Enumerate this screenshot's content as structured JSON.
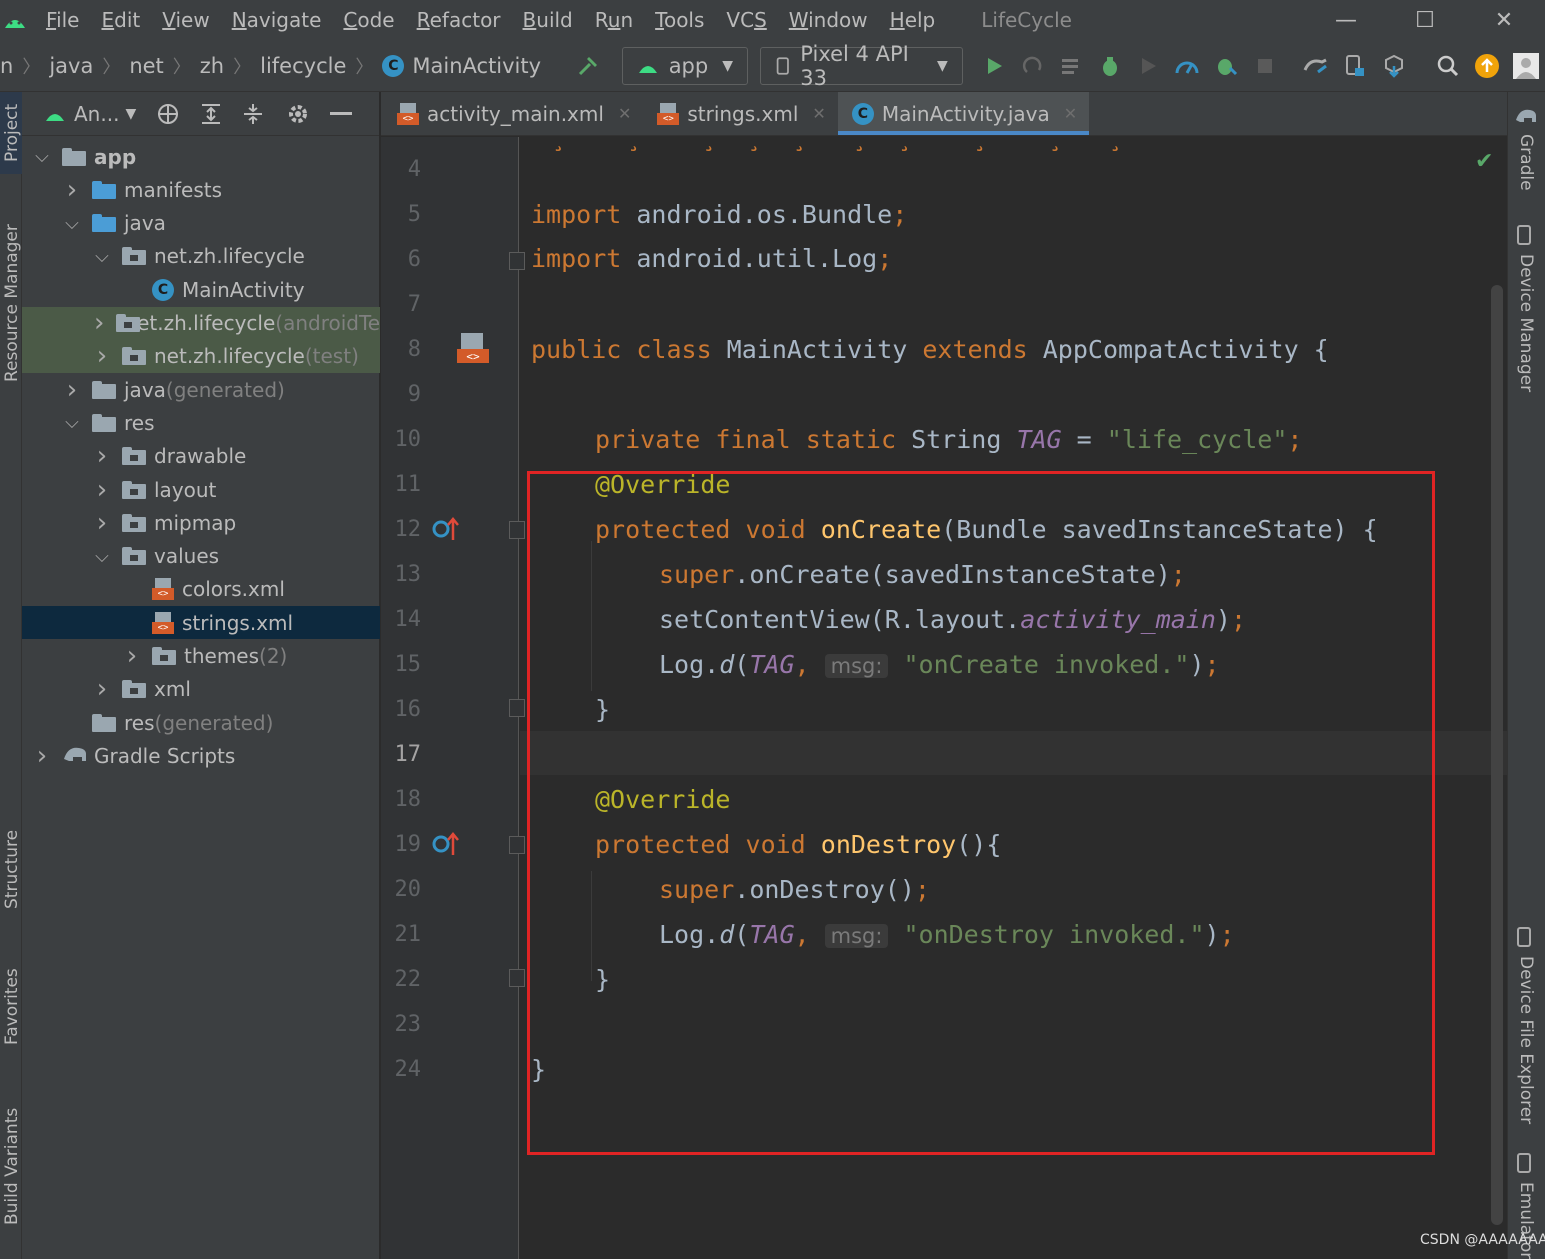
{
  "menubar": {
    "items": [
      {
        "pre": "",
        "mn": "F",
        "post": "ile"
      },
      {
        "pre": "",
        "mn": "E",
        "post": "dit"
      },
      {
        "pre": "",
        "mn": "V",
        "post": "iew"
      },
      {
        "pre": "",
        "mn": "N",
        "post": "avigate"
      },
      {
        "pre": "",
        "mn": "C",
        "post": "ode"
      },
      {
        "pre": "",
        "mn": "R",
        "post": "efactor"
      },
      {
        "pre": "",
        "mn": "B",
        "post": "uild"
      },
      {
        "pre": "R",
        "mn": "u",
        "post": "n"
      },
      {
        "pre": "",
        "mn": "T",
        "post": "ools"
      },
      {
        "pre": "VC",
        "mn": "S",
        "post": ""
      },
      {
        "pre": "",
        "mn": "W",
        "post": "indow"
      },
      {
        "pre": "",
        "mn": "H",
        "post": "elp"
      }
    ],
    "project_name": "LifeCycle",
    "window_controls": {
      "minimize": "—",
      "maximize": "☐",
      "close": "✕"
    }
  },
  "navbar": {
    "breadcrumbs": [
      "n",
      "java",
      "net",
      "zh",
      "lifecycle",
      "MainActivity"
    ],
    "run_config": "app",
    "device": "Pixel 4 API 33"
  },
  "project_panel": {
    "view_label": "An...",
    "tree": [
      {
        "label": "app",
        "muted": "",
        "chev": "v",
        "icon": "folder-gray"
      },
      {
        "label": "manifests",
        "muted": "",
        "chev": ">",
        "icon": "folder-blue"
      },
      {
        "label": "java",
        "muted": "",
        "chev": "v",
        "icon": "folder-blue"
      },
      {
        "label": "net.zh.lifecycle",
        "muted": "",
        "chev": "v",
        "icon": "package"
      },
      {
        "label": "MainActivity",
        "muted": "",
        "chev": "",
        "icon": "class"
      },
      {
        "label": "net.zh.lifecycle",
        "muted": " (androidTest)",
        "chev": ">",
        "icon": "package"
      },
      {
        "label": "net.zh.lifecycle",
        "muted": " (test)",
        "chev": ">",
        "icon": "package"
      },
      {
        "label": "java",
        "muted": " (generated)",
        "chev": ">",
        "icon": "folder-gen"
      },
      {
        "label": "res",
        "muted": "",
        "chev": "v",
        "icon": "folder-res"
      },
      {
        "label": "drawable",
        "muted": "",
        "chev": ">",
        "icon": "package"
      },
      {
        "label": "layout",
        "muted": "",
        "chev": ">",
        "icon": "package"
      },
      {
        "label": "mipmap",
        "muted": "",
        "chev": ">",
        "icon": "package"
      },
      {
        "label": "values",
        "muted": "",
        "chev": "v",
        "icon": "package"
      },
      {
        "label": "colors.xml",
        "muted": "",
        "chev": "",
        "icon": "xml"
      },
      {
        "label": "strings.xml",
        "muted": "",
        "chev": "",
        "icon": "xml"
      },
      {
        "label": "themes",
        "muted": " (2)",
        "chev": ">",
        "icon": "package"
      },
      {
        "label": "xml",
        "muted": "",
        "chev": ">",
        "icon": "package"
      },
      {
        "label": "res",
        "muted": " (generated)",
        "chev": "",
        "icon": "folder-res"
      },
      {
        "label": "Gradle Scripts",
        "muted": "",
        "chev": ">",
        "icon": "gradle"
      }
    ]
  },
  "editor_tabs": [
    {
      "label": "activity_main.xml",
      "icon": "xml"
    },
    {
      "label": "strings.xml",
      "icon": "xml"
    },
    {
      "label": "MainActivity.java",
      "icon": "class"
    }
  ],
  "active_tab": "MainActivity.java",
  "left_tool_tabs": [
    "Project",
    "Resource Manager",
    "Structure",
    "Favorites",
    "Build Variants"
  ],
  "right_tool_tabs": [
    "Gradle",
    "Device Manager",
    "Device File Explorer",
    "Emulator"
  ],
  "editor": {
    "line_numbers": [
      "4",
      "5",
      "6",
      "7",
      "8",
      "9",
      "10",
      "11",
      "12",
      "13",
      "14",
      "15",
      "16",
      "17",
      "18",
      "19",
      "20",
      "21",
      "22",
      "23",
      "24"
    ],
    "current_line": "17",
    "code": {
      "l5": {
        "kw": "import",
        "rest": " android.os.Bundle",
        "semi": ";"
      },
      "l6": {
        "kw": "import",
        "rest": " android.util.Log",
        "semi": ";"
      },
      "l8": {
        "kw": "public class",
        "name": " MainActivity ",
        "kw2": "extends",
        "rest": " AppCompatActivity {"
      },
      "l10": {
        "kw": "private final static",
        "type": " String ",
        "cst": "TAG",
        "eq": " = ",
        "str": "\"life_cycle\"",
        "semi": ";"
      },
      "l11": {
        "ann": "@Override"
      },
      "l12": {
        "kw": "protected void",
        "fn": " onCreate",
        "rest": "(Bundle savedInstanceState) {"
      },
      "l13": {
        "kw": "super",
        "rest": ".onCreate(savedInstanceState)",
        "semi": ";"
      },
      "l14": {
        "rest": "setContentView(R.layout.",
        "cst": "activity_main",
        "rest2": ")",
        "semi": ";"
      },
      "l15": {
        "rest": "Log.",
        "it": "d",
        "paren": "(",
        "cst": "TAG",
        "comma": ", ",
        "hint": "msg:",
        "str": " \"onCreate invoked.\"",
        "close": ")",
        "semi": ";"
      },
      "l16": {
        "rest": "}"
      },
      "l18": {
        "ann": "@Override"
      },
      "l19": {
        "kw": "protected void",
        "fn": " onDestroy",
        "rest": "(){"
      },
      "l20": {
        "kw": "super",
        "rest": ".onDestroy()",
        "semi": ";"
      },
      "l21": {
        "rest": "Log.",
        "it": "d",
        "paren": "(",
        "cst": "TAG",
        "comma": ", ",
        "hint": "msg:",
        "str": " \"onDestroy invoked.\"",
        "close": ")",
        "semi": ";"
      },
      "l22": {
        "rest": "}"
      },
      "l24": {
        "rest": "}"
      }
    }
  },
  "watermark": "CSDN @AAAAAAAi",
  "colors": {
    "accent": "#4a88c7",
    "highlight_box": "#e02424",
    "keyword": "#cc7832",
    "string": "#6a8759",
    "annotation": "#bbb529"
  }
}
